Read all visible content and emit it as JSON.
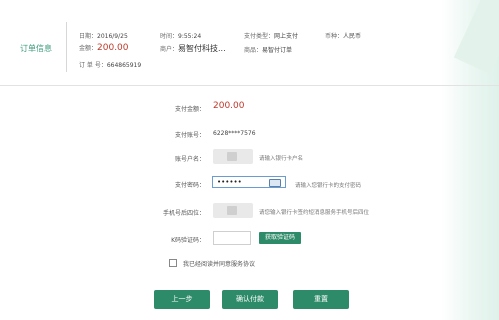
{
  "order": {
    "title": "订单信息",
    "date_label": "日期：",
    "date_value": "2016/9/25",
    "time_label": "时间：",
    "time_value": "9:55:24",
    "pay_type_label": "支付类型：",
    "pay_type_value": "网上支付",
    "currency_label": "币种：",
    "currency_value": "人民币",
    "amount_label": "金额：",
    "amount_value": "200.00",
    "merchant_label": "商户：",
    "merchant_value": "易智付科技...",
    "product_label": "商品：",
    "product_value": "易智付订单",
    "order_no_label": "订 单 号：",
    "order_no_value": "664865919"
  },
  "form": {
    "pay_amount_label": "支付金额：",
    "pay_amount_value": "200.00",
    "pay_account_label": "支付账号：",
    "pay_account_value": "6228****7576",
    "account_name_label": "账号户名：",
    "account_name_hint": "请输入银行卡户名",
    "password_label": "支付密码：",
    "password_dots": "••••••",
    "password_hint": "请输入您银行卡的支付密码",
    "phone_label": "手机号后四位：",
    "phone_hint": "请您输入银行卡签约短消息服务手机号后四位",
    "k_code_label": "K码验证码：",
    "get_code_button": "获取验证码",
    "agree_text": "我已经阅读并同意服务协议"
  },
  "actions": {
    "prev": "上一步",
    "confirm": "确认付款",
    "reset": "重置"
  },
  "colors": {
    "accent": "#2e8b6a",
    "amount": "#c0392b"
  }
}
